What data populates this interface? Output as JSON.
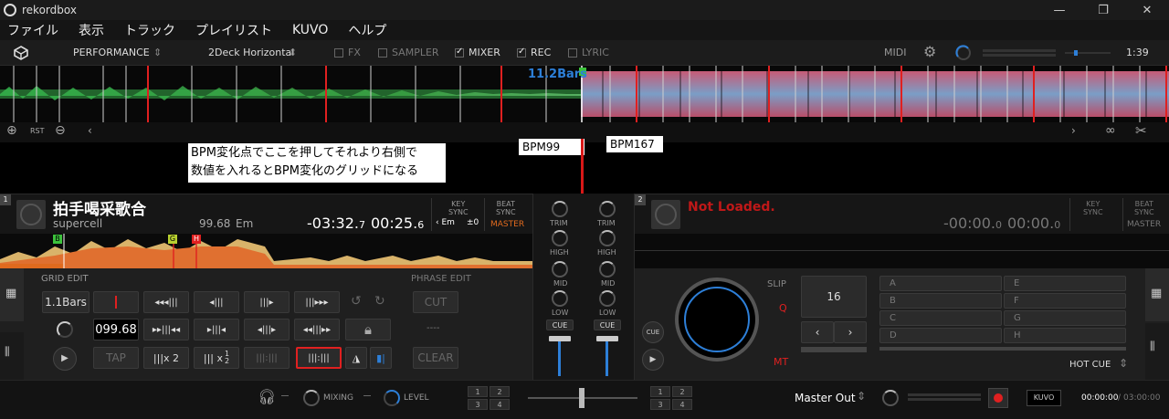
{
  "window": {
    "title": "rekordbox",
    "minimize": "—",
    "maximize": "❐",
    "close": "✕"
  },
  "menu": [
    "ファイル",
    "表示",
    "トラック",
    "プレイリスト",
    "KUVO",
    "ヘルプ"
  ],
  "toolbar": {
    "mode": "PERFORMANCE",
    "layout": "2Deck Horizontal",
    "toggles": [
      {
        "label": "FX",
        "on": false
      },
      {
        "label": "SAMPLER",
        "on": false
      },
      {
        "label": "MIXER",
        "on": true
      },
      {
        "label": "REC",
        "on": true
      },
      {
        "label": "LYRIC",
        "on": false
      }
    ],
    "midi": "MIDI",
    "time": "1:39"
  },
  "wave": {
    "bars_label": "11.2Bars",
    "rst": "RST"
  },
  "annotation": {
    "note_line1": "BPM変化点でここを押してそれより右側で",
    "note_line2": "数値を入れるとBPM変化のグリッドになる",
    "bpm_left": "BPM99",
    "bpm_right": "BPM167"
  },
  "deck1": {
    "number": "1",
    "title": "拍手喝采歌合",
    "artist": "supercell",
    "bpm": "99.68",
    "key": "Em",
    "remain_main": "-03:32.",
    "remain_frac": "7",
    "elapsed_main": "00:25.",
    "elapsed_frac": "6",
    "key_sync": "KEY\nSYNC",
    "key_value": "Em",
    "key_offset": "±0",
    "beat_sync": "BEAT\nSYNC",
    "master": "MASTER",
    "cues": [
      "B",
      "G",
      "H"
    ],
    "grid_edit": "GRID EDIT",
    "phrase_edit": "PHRASE EDIT",
    "bars": "1.1Bars",
    "bpm_field": "099.68",
    "tap": "TAP",
    "x2": "x 2",
    "x_half_num": "1",
    "x_half_den": "2",
    "cut": "CUT",
    "dashes": "----",
    "clear": "CLEAR"
  },
  "mixer": {
    "trim": "TRIM",
    "high": "HIGH",
    "mid": "MID",
    "low": "LOW",
    "cue": "CUE"
  },
  "deck2": {
    "number": "2",
    "title": "Not Loaded.",
    "remain_main": "-00:00.",
    "remain_frac": "0",
    "elapsed_main": "00:00.",
    "elapsed_frac": "0",
    "key_sync": "KEY\nSYNC",
    "beat_sync": "BEAT\nSYNC",
    "master": "MASTER",
    "slip": "SLIP",
    "q": "Q",
    "mt": "MT",
    "cue": "CUE",
    "beat_count": "16",
    "hotcues_left": [
      "A",
      "B",
      "C",
      "D"
    ],
    "hotcues_right": [
      "E",
      "F",
      "G",
      "H"
    ],
    "hot_cue_label": "HOT CUE"
  },
  "bottom": {
    "mixing": "MIXING",
    "level": "LEVEL",
    "grid_nums": [
      "1",
      "2",
      "3",
      "4"
    ],
    "master_out": "Master Out",
    "kuvo": "KUVO",
    "rec_time": "00:00:00",
    "rec_sep": "/",
    "rec_total": "03:00:00"
  },
  "colors": {
    "accent_red": "#e02020",
    "accent_blue": "#2d7fd8",
    "orange": "#e06a1e",
    "green": "#3cc23c"
  }
}
